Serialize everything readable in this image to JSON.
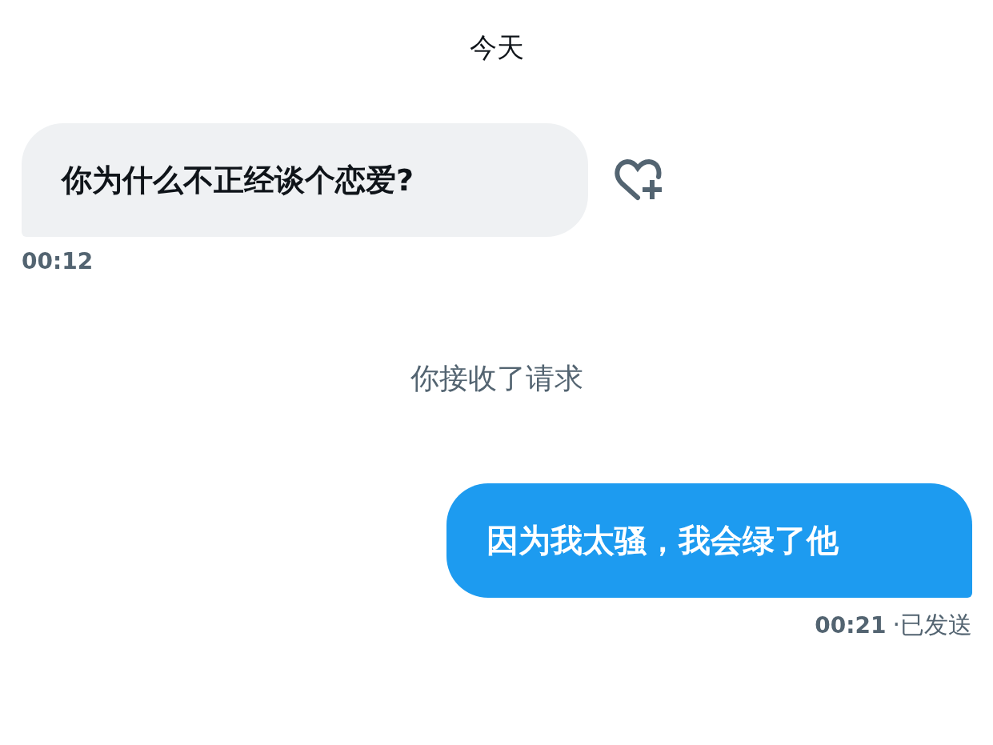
{
  "date_header": "今天",
  "messages": [
    {
      "kind": "incoming",
      "text": "你为什么不正经谈个恋爱?",
      "time": "00:12"
    },
    {
      "kind": "system",
      "text": "你接收了请求"
    },
    {
      "kind": "outgoing",
      "text": "因为我太骚，我会绿了他",
      "time": "00:21",
      "status": "·已发送"
    }
  ]
}
